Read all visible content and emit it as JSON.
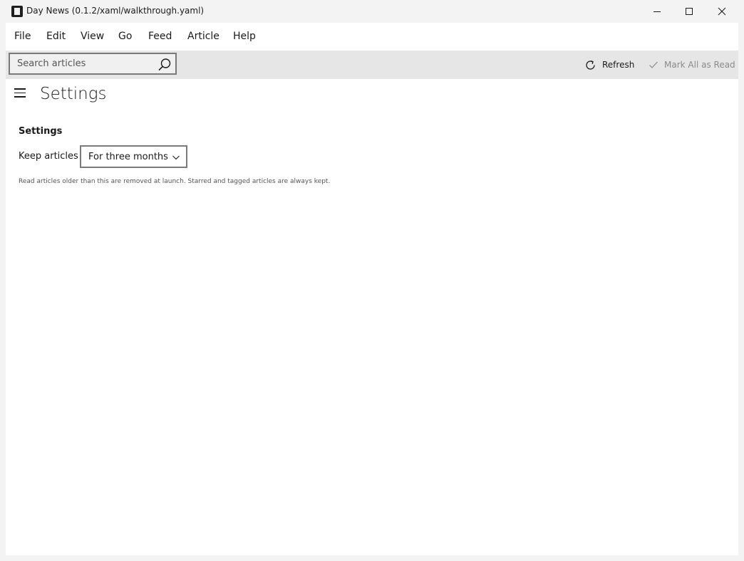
{
  "window": {
    "title": "Day News (0.1.2/xaml/walkthrough.yaml)",
    "icons": [
      "app-icon",
      "minimize-icon",
      "maximize-icon",
      "close-icon"
    ]
  },
  "menu": {
    "items": [
      {
        "label": "File"
      },
      {
        "label": "Edit"
      },
      {
        "label": "View"
      },
      {
        "label": "Go"
      },
      {
        "label": "Feed"
      },
      {
        "label": "Article"
      },
      {
        "label": "Help"
      }
    ]
  },
  "toolbar": {
    "search": {
      "placeholder": "Search articles",
      "icon": "search-icon"
    },
    "refresh_label": "Refresh",
    "mark_all_read_label": "Mark All as Read",
    "mark_all_read_enabled": false
  },
  "page": {
    "title": "Settings",
    "section_heading": "Settings",
    "keep_articles": {
      "label": "Keep articles",
      "selected": "For three months"
    },
    "help_text": "Read articles older than this are removed at launch. Starred and tagged articles are always kept."
  },
  "colors": {
    "title_bar": "#f3f3f3",
    "toolbar": "#e6e6e6",
    "content": "#ffffff",
    "disabled_text": "#8a8a8a"
  }
}
